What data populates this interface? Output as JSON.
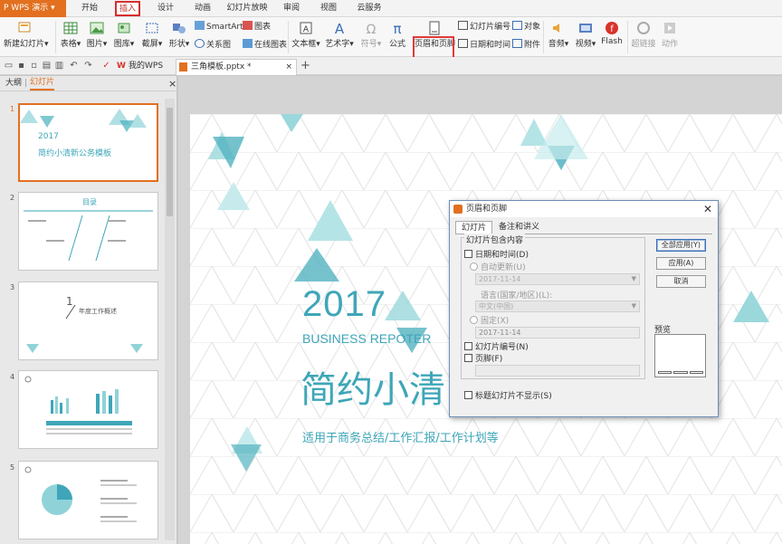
{
  "app": {
    "name": "WPS 演示",
    "menu_tabs": [
      "开始",
      "插入",
      "设计",
      "动画",
      "幻灯片放映",
      "审阅",
      "视图",
      "云服务"
    ],
    "active_tab": "插入"
  },
  "ribbon": {
    "new_slide": "新建幻灯片",
    "table": "表格",
    "picture": "图片",
    "gallery": "图库",
    "screenshot": "截屏",
    "shapes": "形状",
    "smartart": "SmartArt",
    "chart": "图表",
    "relation": "关系图",
    "online_chart": "在线图表",
    "textbox": "文本框",
    "wordart": "艺术字",
    "symbol": "符号",
    "formula": "公式",
    "header_footer": "页眉和页脚",
    "slide_number": "幻灯片编号",
    "object": "对象",
    "datetime": "日期和时间",
    "attachment": "附件",
    "audio": "音频",
    "video": "视频",
    "flash": "Flash",
    "hyperlink": "超链接",
    "action": "动作"
  },
  "docbar": {
    "tab1": "我的WPS",
    "tab2": "三角模板.pptx *"
  },
  "pane": {
    "tab_outline": "大纲",
    "tab_slides": "幻灯片",
    "close": "×"
  },
  "thumbs": [
    {
      "num": "1",
      "year": "2017",
      "title": "简约小清新公务模板"
    },
    {
      "num": "2",
      "title": "目录"
    },
    {
      "num": "3",
      "title": "年度工作概述",
      "index": "1"
    },
    {
      "num": "4"
    },
    {
      "num": "5"
    }
  ],
  "slide": {
    "year": "2017",
    "subtitle": "BUSINESS REPOTER",
    "title": "简约小清",
    "tagline": "适用于商务总结/工作汇报/工作计划等"
  },
  "dialog": {
    "title": "页眉和页脚",
    "close": "✕",
    "tab_slide": "幻灯片",
    "tab_notes": "备注和讲义",
    "group_label": "幻灯片包含内容",
    "datetime": "日期和时间(D)",
    "auto_update": "自动更新(U)",
    "auto_value": "2017-11-14",
    "language_label": "语言(国家/地区)(L):",
    "language_value": "中文(中国)",
    "fixed": "固定(X)",
    "fixed_value": "2017-11-14",
    "slide_number": "幻灯片编号(N)",
    "footer": "页脚(F)",
    "no_title_slide": "标题幻灯片不显示(S)",
    "btn_apply_all": "全部应用(Y)",
    "btn_apply": "应用(A)",
    "btn_cancel": "取消",
    "preview": "预览"
  },
  "colors": {
    "accent": "#3ea6b8",
    "wps_orange": "#e2701f",
    "highlight": "#e03a3a"
  }
}
